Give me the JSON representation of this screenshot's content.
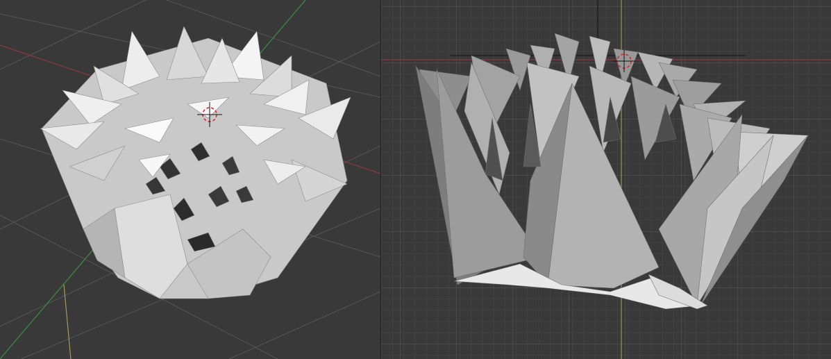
{
  "viewports": [
    {
      "id": "left",
      "view": "user-perspective",
      "background": "#393939",
      "grid_color": "#555555",
      "x_axis_color": "#8c3a3a",
      "y_axis_color": "#3e8f3e",
      "z_axis_color": "#a59a5e"
    },
    {
      "id": "right",
      "view": "front-orthographic",
      "background": "#393939",
      "grid_minor_color": "#474747",
      "grid_major_color": "#5a5a5a",
      "x_axis_color": "#8c3a3a",
      "z_axis_color": "#8f9a5a"
    }
  ],
  "scene": {
    "object": "spiky-polygonal-mesh",
    "cursor": "3d-cursor"
  }
}
